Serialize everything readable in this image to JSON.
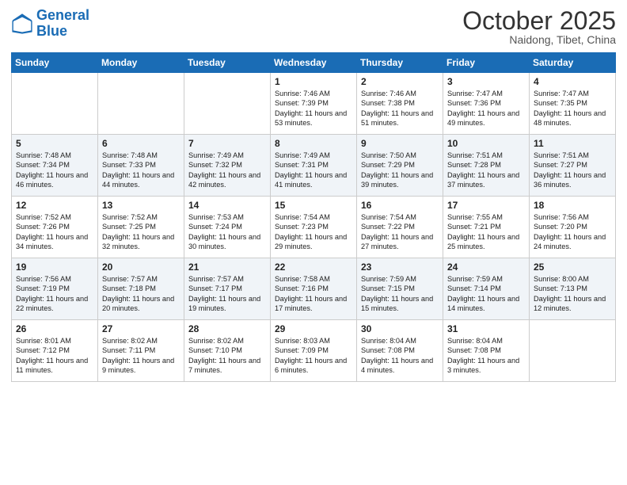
{
  "header": {
    "logo_text_general": "General",
    "logo_text_blue": "Blue",
    "month": "October 2025",
    "location": "Naidong, Tibet, China"
  },
  "weekdays": [
    "Sunday",
    "Monday",
    "Tuesday",
    "Wednesday",
    "Thursday",
    "Friday",
    "Saturday"
  ],
  "weeks": [
    [
      {
        "day": "",
        "content": ""
      },
      {
        "day": "",
        "content": ""
      },
      {
        "day": "",
        "content": ""
      },
      {
        "day": "1",
        "content": "Sunrise: 7:46 AM\nSunset: 7:39 PM\nDaylight: 11 hours\nand 53 minutes."
      },
      {
        "day": "2",
        "content": "Sunrise: 7:46 AM\nSunset: 7:38 PM\nDaylight: 11 hours\nand 51 minutes."
      },
      {
        "day": "3",
        "content": "Sunrise: 7:47 AM\nSunset: 7:36 PM\nDaylight: 11 hours\nand 49 minutes."
      },
      {
        "day": "4",
        "content": "Sunrise: 7:47 AM\nSunset: 7:35 PM\nDaylight: 11 hours\nand 48 minutes."
      }
    ],
    [
      {
        "day": "5",
        "content": "Sunrise: 7:48 AM\nSunset: 7:34 PM\nDaylight: 11 hours\nand 46 minutes."
      },
      {
        "day": "6",
        "content": "Sunrise: 7:48 AM\nSunset: 7:33 PM\nDaylight: 11 hours\nand 44 minutes."
      },
      {
        "day": "7",
        "content": "Sunrise: 7:49 AM\nSunset: 7:32 PM\nDaylight: 11 hours\nand 42 minutes."
      },
      {
        "day": "8",
        "content": "Sunrise: 7:49 AM\nSunset: 7:31 PM\nDaylight: 11 hours\nand 41 minutes."
      },
      {
        "day": "9",
        "content": "Sunrise: 7:50 AM\nSunset: 7:29 PM\nDaylight: 11 hours\nand 39 minutes."
      },
      {
        "day": "10",
        "content": "Sunrise: 7:51 AM\nSunset: 7:28 PM\nDaylight: 11 hours\nand 37 minutes."
      },
      {
        "day": "11",
        "content": "Sunrise: 7:51 AM\nSunset: 7:27 PM\nDaylight: 11 hours\nand 36 minutes."
      }
    ],
    [
      {
        "day": "12",
        "content": "Sunrise: 7:52 AM\nSunset: 7:26 PM\nDaylight: 11 hours\nand 34 minutes."
      },
      {
        "day": "13",
        "content": "Sunrise: 7:52 AM\nSunset: 7:25 PM\nDaylight: 11 hours\nand 32 minutes."
      },
      {
        "day": "14",
        "content": "Sunrise: 7:53 AM\nSunset: 7:24 PM\nDaylight: 11 hours\nand 30 minutes."
      },
      {
        "day": "15",
        "content": "Sunrise: 7:54 AM\nSunset: 7:23 PM\nDaylight: 11 hours\nand 29 minutes."
      },
      {
        "day": "16",
        "content": "Sunrise: 7:54 AM\nSunset: 7:22 PM\nDaylight: 11 hours\nand 27 minutes."
      },
      {
        "day": "17",
        "content": "Sunrise: 7:55 AM\nSunset: 7:21 PM\nDaylight: 11 hours\nand 25 minutes."
      },
      {
        "day": "18",
        "content": "Sunrise: 7:56 AM\nSunset: 7:20 PM\nDaylight: 11 hours\nand 24 minutes."
      }
    ],
    [
      {
        "day": "19",
        "content": "Sunrise: 7:56 AM\nSunset: 7:19 PM\nDaylight: 11 hours\nand 22 minutes."
      },
      {
        "day": "20",
        "content": "Sunrise: 7:57 AM\nSunset: 7:18 PM\nDaylight: 11 hours\nand 20 minutes."
      },
      {
        "day": "21",
        "content": "Sunrise: 7:57 AM\nSunset: 7:17 PM\nDaylight: 11 hours\nand 19 minutes."
      },
      {
        "day": "22",
        "content": "Sunrise: 7:58 AM\nSunset: 7:16 PM\nDaylight: 11 hours\nand 17 minutes."
      },
      {
        "day": "23",
        "content": "Sunrise: 7:59 AM\nSunset: 7:15 PM\nDaylight: 11 hours\nand 15 minutes."
      },
      {
        "day": "24",
        "content": "Sunrise: 7:59 AM\nSunset: 7:14 PM\nDaylight: 11 hours\nand 14 minutes."
      },
      {
        "day": "25",
        "content": "Sunrise: 8:00 AM\nSunset: 7:13 PM\nDaylight: 11 hours\nand 12 minutes."
      }
    ],
    [
      {
        "day": "26",
        "content": "Sunrise: 8:01 AM\nSunset: 7:12 PM\nDaylight: 11 hours\nand 11 minutes."
      },
      {
        "day": "27",
        "content": "Sunrise: 8:02 AM\nSunset: 7:11 PM\nDaylight: 11 hours\nand 9 minutes."
      },
      {
        "day": "28",
        "content": "Sunrise: 8:02 AM\nSunset: 7:10 PM\nDaylight: 11 hours\nand 7 minutes."
      },
      {
        "day": "29",
        "content": "Sunrise: 8:03 AM\nSunset: 7:09 PM\nDaylight: 11 hours\nand 6 minutes."
      },
      {
        "day": "30",
        "content": "Sunrise: 8:04 AM\nSunset: 7:08 PM\nDaylight: 11 hours\nand 4 minutes."
      },
      {
        "day": "31",
        "content": "Sunrise: 8:04 AM\nSunset: 7:08 PM\nDaylight: 11 hours\nand 3 minutes."
      },
      {
        "day": "",
        "content": ""
      }
    ]
  ]
}
